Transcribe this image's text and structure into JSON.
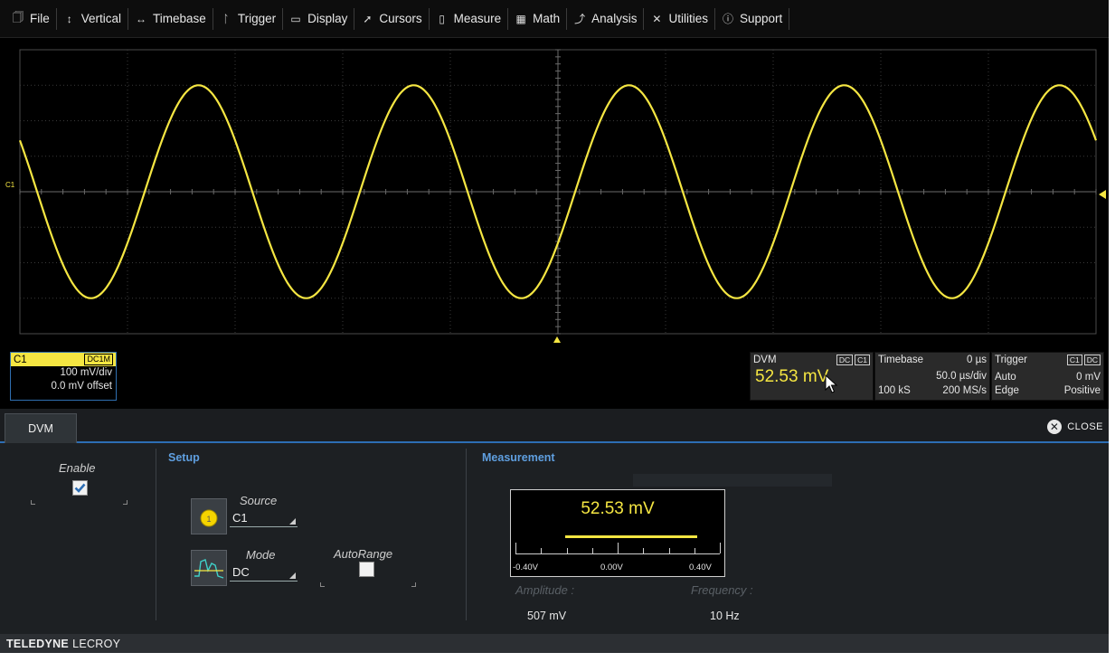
{
  "menu": [
    {
      "icon": "file-icon",
      "glyph": "🗍",
      "label": "File"
    },
    {
      "icon": "vertical-icon",
      "glyph": "↕",
      "label": "Vertical"
    },
    {
      "icon": "timebase-icon",
      "glyph": "↔",
      "label": "Timebase"
    },
    {
      "icon": "trigger-icon",
      "glyph": "ᛚ",
      "label": "Trigger"
    },
    {
      "icon": "display-icon",
      "glyph": "▭",
      "label": "Display"
    },
    {
      "icon": "cursors-icon",
      "glyph": "➚",
      "label": "Cursors"
    },
    {
      "icon": "measure-icon",
      "glyph": "▯",
      "label": "Measure"
    },
    {
      "icon": "math-icon",
      "glyph": "▦",
      "label": "Math"
    },
    {
      "icon": "analysis-icon",
      "glyph": "⤴",
      "label": "Analysis"
    },
    {
      "icon": "utilities-icon",
      "glyph": "✕",
      "label": "Utilities"
    },
    {
      "icon": "support-icon",
      "glyph": "ⓘ",
      "label": "Support"
    }
  ],
  "trace": {
    "channel_marker": "C1",
    "color": "#f5e642",
    "cycles": 5,
    "amplitude_div": 3.0
  },
  "channel": {
    "name": "C1",
    "coupling": "DC1M",
    "scale": "100 mV/div",
    "offset": "0.0 mV offset"
  },
  "dvm_descriptor": {
    "title": "DVM",
    "tag1": "DC",
    "tag2": "C1",
    "value": "52.53 mV"
  },
  "timebase": {
    "title": "Timebase",
    "delay": "0 µs",
    "scale": "50.0 µs/div",
    "samples": "100 kS",
    "rate": "200 MS/s"
  },
  "trigger": {
    "title": "Trigger",
    "tag1": "C1",
    "tag2": "DC",
    "mode": "Auto",
    "level": "0 mV",
    "type": "Edge",
    "slope": "Positive"
  },
  "panel": {
    "tab": "DVM",
    "close_label": "CLOSE",
    "enable_label": "Enable",
    "enable_checked": true,
    "setup_title": "Setup",
    "source_label": "Source",
    "source_value": "C1",
    "mode_label": "Mode",
    "mode_value": "DC",
    "autorange_label": "AutoRange",
    "autorange_checked": false,
    "measurement_title": "Measurement",
    "meter_value": "52.53 mV",
    "meter_min": "-0.40V",
    "meter_mid": "0.00V",
    "meter_max": "0.40V",
    "meter_level": 0.0525,
    "amplitude_label": "Amplitude :",
    "amplitude_value": "507 mV",
    "frequency_label": "Frequency :",
    "frequency_value": "10 Hz"
  },
  "footer": {
    "brand_bold": "TELEDYNE",
    "brand_rest": "LECROY"
  }
}
